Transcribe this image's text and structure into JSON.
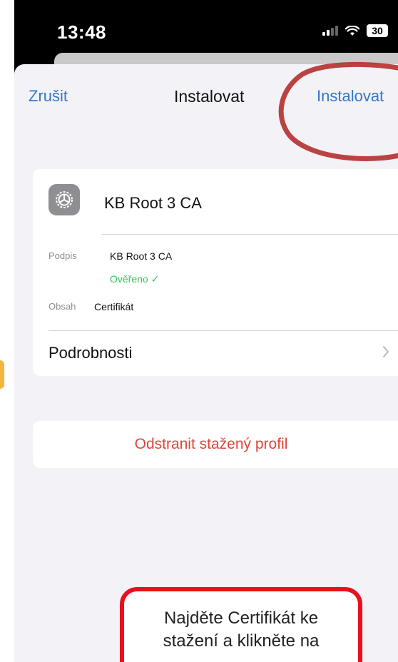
{
  "status_bar": {
    "time": "13:48",
    "battery": "30"
  },
  "nav": {
    "cancel": "Zrušit",
    "title": "Instalovat",
    "install": "Instalovat"
  },
  "profile": {
    "name": "KB Root 3 CA",
    "signature_label": "Podpis",
    "signature_value": "KB Root 3 CA",
    "verified": "Ověřeno ✓",
    "content_label": "Obsah",
    "content_value": "Certifikát",
    "details": "Podrobnosti"
  },
  "remove_profile": "Odstranit stažený profil",
  "callout": {
    "line1": "Najděte Certifikát ke",
    "line2": "stažení a klikněte na"
  },
  "colors": {
    "link": "#3478c4",
    "destructive": "#e0443a",
    "verified": "#34c759",
    "highlight": "#b4302c",
    "callout_border": "#e8101c"
  }
}
